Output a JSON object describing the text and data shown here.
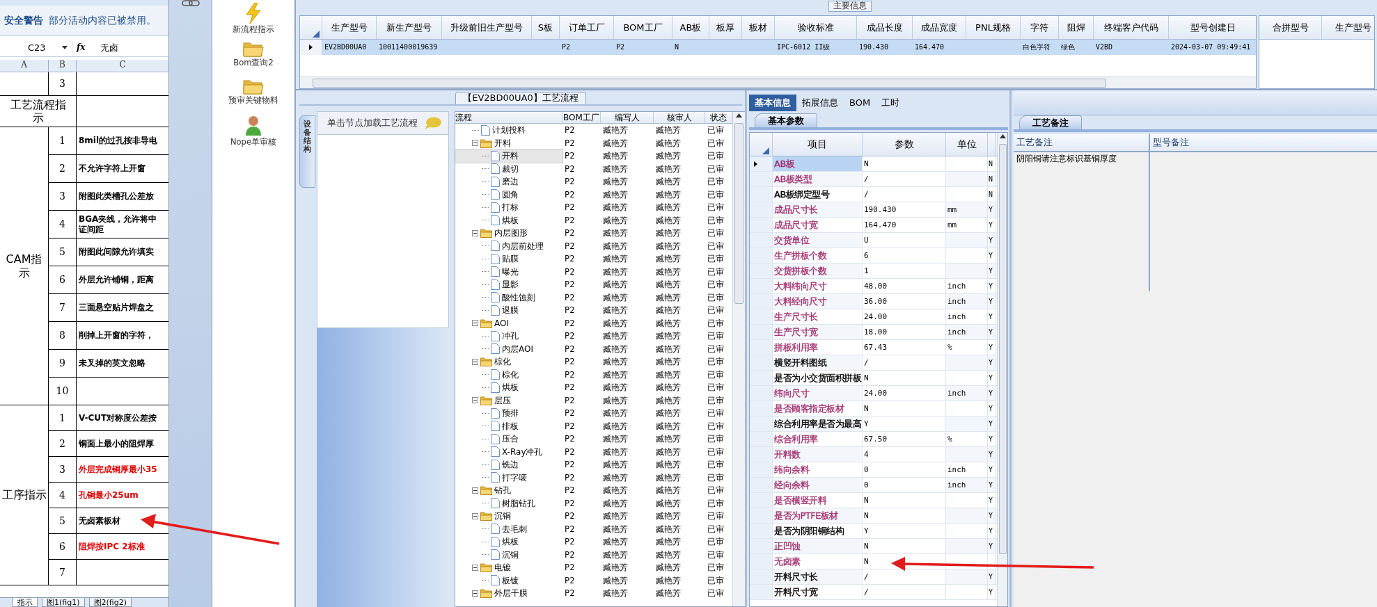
{
  "excel": {
    "warning_title": "安全警告",
    "warning_text": "部分活动内容已被禁用。",
    "name_box": "C23",
    "fx_label": "fx",
    "formula": "无卤",
    "columns": [
      "A",
      "B",
      "C"
    ],
    "top_rows": [
      {
        "number": "3"
      }
    ],
    "flow_label": "工艺流程指示",
    "groups": [
      {
        "label": "CAM指示",
        "items": [
          {
            "number": "1",
            "text": "8mil的过孔按非导电",
            "color": "#000000"
          },
          {
            "number": "2",
            "text": "不允许字符上开窗",
            "color": "#000000"
          },
          {
            "number": "3",
            "text": "附图此类槽孔公差放",
            "color": "#000000"
          },
          {
            "number": "4",
            "text": "BGA夹线，允许将中证间距",
            "color": "#000000"
          },
          {
            "number": "5",
            "text": "附图此间隙允许填实",
            "color": "#000000"
          },
          {
            "number": "6",
            "text": "外层允许铺铜，距离",
            "color": "#000000"
          },
          {
            "number": "7",
            "text": "三面悬空贴片焊盘之",
            "color": "#000000"
          },
          {
            "number": "8",
            "text": "削掉上开窗的字符，",
            "color": "#000000"
          },
          {
            "number": "9",
            "text": "未叉掉的英文忽略",
            "color": "#000000"
          },
          {
            "number": "10"
          }
        ]
      },
      {
        "label": "工序指示",
        "items": [
          {
            "number": "1",
            "text": "V-CUT对称度公差按",
            "color": "#000000"
          },
          {
            "number": "2",
            "text": "铜面上最小的阻焊厚",
            "color": "#000000"
          },
          {
            "number": "3",
            "text": "外层完成铜厚最小35",
            "color": "#e00000"
          },
          {
            "number": "4",
            "text": "孔铜最小25um",
            "color": "#e00000"
          },
          {
            "number": "5",
            "text": "无卤素板材",
            "color": "#000000"
          },
          {
            "number": "6",
            "text": "阻焊按IPC 2标准",
            "color": "#e00000"
          },
          {
            "number": "7"
          }
        ]
      }
    ],
    "sheet_tabs": [
      {
        "label": "指示",
        "selected": true
      },
      {
        "label": "图1(fig1)",
        "selected": false
      },
      {
        "label": "图2(fig2)",
        "selected": false
      }
    ]
  },
  "toolbar": [
    {
      "label": "新流程指示",
      "kind": "lightning"
    },
    {
      "label": "Bom查询2",
      "kind": "folder"
    },
    {
      "label": "预审关键物料",
      "kind": "folder"
    },
    {
      "label": "Nope单审核",
      "kind": "person"
    }
  ],
  "main_info": {
    "title": "主要信息",
    "columns": [
      "生产型号",
      "新生产型号",
      "升级前旧生产型号",
      "S板",
      "订单工厂",
      "BOM工厂",
      "AB板",
      "板厚",
      "板材",
      "验收标准",
      "成品长度",
      "成品宽度",
      "PNL规格",
      "字符",
      "阻焊",
      "终端客户代码",
      "型号创建日"
    ],
    "rows": [
      {
        "selected": true,
        "cells": [
          "EV2BD00UA0",
          "10011400019639",
          null,
          null,
          "P2",
          "P2",
          "N",
          null,
          null,
          "IPC-6012 II级",
          "190.430",
          "164.470",
          null,
          "白色字符",
          "绿色",
          "V2BD",
          "2024-03-07 09:49:41"
        ]
      }
    ],
    "side_columns": [
      "合拼型号",
      "生产型号"
    ]
  },
  "process": {
    "title": "【EV2BD00UA0】工艺流程",
    "side_tab": "设备结构",
    "hint": "单击节点加载工艺流程",
    "columns": [
      "流程",
      "BOM工厂",
      "编写人",
      "核审人",
      "状态"
    ],
    "rows": [
      {
        "kind": "file",
        "label": "计划投料",
        "factory": "P2",
        "writer": "臧艳芳",
        "reviewer": "臧艳芳",
        "status": "已审",
        "selected": false
      },
      {
        "kind": "folder",
        "label": "开料",
        "factory": "P2",
        "writer": "臧艳芳",
        "reviewer": "臧艳芳",
        "status": "已审",
        "selected": false,
        "expanded": true,
        "children": [
          {
            "kind": "file",
            "label": "开料",
            "factory": "P2",
            "writer": "臧艳芳",
            "reviewer": "臧艳芳",
            "status": "已审",
            "selected": true
          },
          {
            "kind": "file",
            "label": "裁切",
            "factory": "P2",
            "writer": "臧艳芳",
            "reviewer": "臧艳芳",
            "status": "已审",
            "selected": false
          },
          {
            "kind": "file",
            "label": "磨边",
            "factory": "P2",
            "writer": "臧艳芳",
            "reviewer": "臧艳芳",
            "status": "已审",
            "selected": false
          },
          {
            "kind": "file",
            "label": "圆角",
            "factory": "P2",
            "writer": "臧艳芳",
            "reviewer": "臧艳芳",
            "status": "已审",
            "selected": false
          },
          {
            "kind": "file",
            "label": "打标",
            "factory": "P2",
            "writer": "臧艳芳",
            "reviewer": "臧艳芳",
            "status": "已审",
            "selected": false
          },
          {
            "kind": "file",
            "label": "烘板",
            "factory": "P2",
            "writer": "臧艳芳",
            "reviewer": "臧艳芳",
            "status": "已审",
            "selected": false
          }
        ]
      },
      {
        "kind": "folder",
        "label": "内层图形",
        "factory": "P2",
        "writer": "臧艳芳",
        "reviewer": "臧艳芳",
        "status": "已审",
        "selected": false,
        "expanded": true,
        "children": [
          {
            "kind": "file",
            "label": "内层前处理",
            "factory": "P2",
            "writer": "臧艳芳",
            "reviewer": "臧艳芳",
            "status": "已审",
            "selected": false
          },
          {
            "kind": "file",
            "label": "贴膜",
            "factory": "P2",
            "writer": "臧艳芳",
            "reviewer": "臧艳芳",
            "status": "已审",
            "selected": false
          },
          {
            "kind": "file",
            "label": "曝光",
            "factory": "P2",
            "writer": "臧艳芳",
            "reviewer": "臧艳芳",
            "status": "已审",
            "selected": false
          },
          {
            "kind": "file",
            "label": "显影",
            "factory": "P2",
            "writer": "臧艳芳",
            "reviewer": "臧艳芳",
            "status": "已审",
            "selected": false
          },
          {
            "kind": "file",
            "label": "酸性蚀刻",
            "factory": "P2",
            "writer": "臧艳芳",
            "reviewer": "臧艳芳",
            "status": "已审",
            "selected": false
          },
          {
            "kind": "file",
            "label": "退膜",
            "factory": "P2",
            "writer": "臧艳芳",
            "reviewer": "臧艳芳",
            "status": "已审",
            "selected": false
          }
        ]
      },
      {
        "kind": "folder",
        "label": "AOI",
        "factory": "P2",
        "writer": "臧艳芳",
        "reviewer": "臧艳芳",
        "status": "已审",
        "selected": false,
        "expanded": true,
        "children": [
          {
            "kind": "file",
            "label": "冲孔",
            "factory": "P2",
            "writer": "臧艳芳",
            "reviewer": "臧艳芳",
            "status": "已审",
            "selected": false
          },
          {
            "kind": "file",
            "label": "内层AOI",
            "factory": "P2",
            "writer": "臧艳芳",
            "reviewer": "臧艳芳",
            "status": "已审",
            "selected": false
          }
        ]
      },
      {
        "kind": "folder",
        "label": "棕化",
        "factory": "P2",
        "writer": "臧艳芳",
        "reviewer": "臧艳芳",
        "status": "已审",
        "selected": false,
        "expanded": true,
        "children": [
          {
            "kind": "file",
            "label": "棕化",
            "factory": "P2",
            "writer": "臧艳芳",
            "reviewer": "臧艳芳",
            "status": "已审",
            "selected": false
          },
          {
            "kind": "file",
            "label": "烘板",
            "factory": "P2",
            "writer": "臧艳芳",
            "reviewer": "臧艳芳",
            "status": "已审",
            "selected": false
          }
        ]
      },
      {
        "kind": "folder",
        "label": "层压",
        "factory": "P2",
        "writer": "臧艳芳",
        "reviewer": "臧艳芳",
        "status": "已审",
        "selected": false,
        "expanded": true,
        "children": [
          {
            "kind": "file",
            "label": "预排",
            "factory": "P2",
            "writer": "臧艳芳",
            "reviewer": "臧艳芳",
            "status": "已审",
            "selected": false
          },
          {
            "kind": "file",
            "label": "排板",
            "factory": "P2",
            "writer": "臧艳芳",
            "reviewer": "臧艳芳",
            "status": "已审",
            "selected": false
          },
          {
            "kind": "file",
            "label": "压合",
            "factory": "P2",
            "writer": "臧艳芳",
            "reviewer": "臧艳芳",
            "status": "已审",
            "selected": false
          },
          {
            "kind": "file",
            "label": "X-Ray冲孔",
            "factory": "P2",
            "writer": "臧艳芳",
            "reviewer": "臧艳芳",
            "status": "已审",
            "selected": false
          },
          {
            "kind": "file",
            "label": "铣边",
            "factory": "P2",
            "writer": "臧艳芳",
            "reviewer": "臧艳芳",
            "status": "已审",
            "selected": false
          },
          {
            "kind": "file",
            "label": "打字唛",
            "factory": "P2",
            "writer": "臧艳芳",
            "reviewer": "臧艳芳",
            "status": "已审",
            "selected": false
          }
        ]
      },
      {
        "kind": "folder",
        "label": "钻孔",
        "factory": "P2",
        "writer": "臧艳芳",
        "reviewer": "臧艳芳",
        "status": "已审",
        "selected": false,
        "expanded": true,
        "children": [
          {
            "kind": "file",
            "label": "树脂钻孔",
            "factory": "P2",
            "writer": "臧艳芳",
            "reviewer": "臧艳芳",
            "status": "已审",
            "selected": false
          }
        ]
      },
      {
        "kind": "folder",
        "label": "沉铜",
        "factory": "P2",
        "writer": "臧艳芳",
        "reviewer": "臧艳芳",
        "status": "已审",
        "selected": false,
        "expanded": true,
        "children": [
          {
            "kind": "file",
            "label": "去毛刺",
            "factory": "P2",
            "writer": "臧艳芳",
            "reviewer": "臧艳芳",
            "status": "已审",
            "selected": false
          },
          {
            "kind": "file",
            "label": "烘板",
            "factory": "P2",
            "writer": "臧艳芳",
            "reviewer": "臧艳芳",
            "status": "已审",
            "selected": false
          },
          {
            "kind": "file",
            "label": "沉铜",
            "factory": "P2",
            "writer": "臧艳芳",
            "reviewer": "臧艳芳",
            "status": "已审",
            "selected": false
          }
        ]
      },
      {
        "kind": "folder",
        "label": "电镀",
        "factory": "P2",
        "writer": "臧艳芳",
        "reviewer": "臧艳芳",
        "status": "已审",
        "selected": false,
        "expanded": true,
        "children": [
          {
            "kind": "file",
            "label": "板镀",
            "factory": "P2",
            "writer": "臧艳芳",
            "reviewer": "臧艳芳",
            "status": "已审",
            "selected": false
          }
        ]
      },
      {
        "kind": "folder",
        "label": "外层干膜",
        "factory": "P2",
        "writer": "臧艳芳",
        "reviewer": "臧艳芳",
        "status": "已审",
        "selected": false,
        "expanded": true
      }
    ]
  },
  "params": {
    "tabs": [
      {
        "label": "基本信息",
        "selected": true
      },
      {
        "label": "拓展信息",
        "selected": false
      },
      {
        "label": "BOM",
        "selected": false
      },
      {
        "label": "工时",
        "selected": false
      }
    ],
    "subtab": "基本参数",
    "columns": [
      "项目",
      "参数",
      "单位"
    ],
    "rows": [
      {
        "item": "AB板",
        "value": "N",
        "flag": "N",
        "color": "#a0306e",
        "selected": true
      },
      {
        "item": "AB板类型",
        "value": "/",
        "flag": "N",
        "color": "#a0306e",
        "selected": false
      },
      {
        "item": "AB板绑定型号",
        "value": "/",
        "flag": "N",
        "color": "#000000",
        "selected": false
      },
      {
        "item": "成品尺寸长",
        "value": "190.430",
        "unit": "mm",
        "flag": "Y",
        "color": "#a0306e",
        "selected": false
      },
      {
        "item": "成品尺寸宽",
        "value": "164.470",
        "unit": "mm",
        "flag": "Y",
        "color": "#a0306e",
        "selected": false
      },
      {
        "item": "交货单位",
        "value": "U",
        "flag": "Y",
        "color": "#a0306e",
        "selected": false
      },
      {
        "item": "生产拼板个数",
        "value": "6",
        "flag": "Y",
        "color": "#a0306e",
        "selected": false
      },
      {
        "item": "交货拼板个数",
        "value": "1",
        "flag": "Y",
        "color": "#a0306e",
        "selected": false
      },
      {
        "item": "大料纬向尺寸",
        "value": "48.00",
        "unit": "inch",
        "flag": "Y",
        "color": "#a0306e",
        "selected": false
      },
      {
        "item": "大料经向尺寸",
        "value": "36.00",
        "unit": "inch",
        "flag": "Y",
        "color": "#a0306e",
        "selected": false
      },
      {
        "item": "生产尺寸长",
        "value": "24.00",
        "unit": "inch",
        "flag": "Y",
        "color": "#a0306e",
        "selected": false
      },
      {
        "item": "生产尺寸宽",
        "value": "18.00",
        "unit": "inch",
        "flag": "Y",
        "color": "#a0306e",
        "selected": false
      },
      {
        "item": "拼板利用率",
        "value": "67.43",
        "unit": "%",
        "flag": "Y",
        "color": "#a0306e",
        "selected": false
      },
      {
        "item": "横竖开料图纸",
        "value": "/",
        "flag": "Y",
        "color": "#000000",
        "selected": false
      },
      {
        "item": "是否为小交货面积拼板",
        "value": "N",
        "flag": "Y",
        "color": "#000000",
        "selected": false
      },
      {
        "item": "纬向尺寸",
        "value": "24.00",
        "unit": "inch",
        "flag": "Y",
        "color": "#a0306e",
        "selected": false
      },
      {
        "item": "是否顾客指定板材",
        "value": "N",
        "flag": "Y",
        "color": "#a0306e",
        "selected": false
      },
      {
        "item": "综合利用率是否为最高",
        "value": "Y",
        "flag": "Y",
        "color": "#000000",
        "selected": false
      },
      {
        "item": "综合利用率",
        "value": "67.50",
        "unit": "%",
        "flag": "Y",
        "color": "#a0306e",
        "selected": false
      },
      {
        "item": "开料数",
        "value": "4",
        "flag": "Y",
        "color": "#a0306e",
        "selected": false
      },
      {
        "item": "纬向余料",
        "value": "0",
        "unit": "inch",
        "flag": "Y",
        "color": "#a0306e",
        "selected": false
      },
      {
        "item": "经向余料",
        "value": "0",
        "unit": "inch",
        "flag": "Y",
        "color": "#a0306e",
        "selected": false
      },
      {
        "item": "是否横竖开料",
        "value": "N",
        "flag": "Y",
        "color": "#a0306e",
        "selected": false
      },
      {
        "item": "是否为PTFE板材",
        "value": "N",
        "flag": "Y",
        "color": "#a0306e",
        "selected": false
      },
      {
        "item": "是否为阴阳铜结构",
        "value": "Y",
        "flag": "Y",
        "color": "#000000",
        "selected": false
      },
      {
        "item": "正凹蚀",
        "value": "N",
        "flag": "Y",
        "color": "#a0306e",
        "selected": false
      },
      {
        "item": "无卤素",
        "value": "N",
        "color": "#a0306e",
        "selected": false
      },
      {
        "item": "开料尺寸长",
        "value": "/",
        "flag": "Y",
        "color": "#000000",
        "selected": false
      },
      {
        "item": "开料尺寸宽",
        "value": "/",
        "flag": "Y",
        "color": "#000000",
        "selected": false
      }
    ]
  },
  "notes": {
    "tab": "工艺备注",
    "columns": [
      "工艺备注",
      "型号备注"
    ],
    "process_note": "阴阳铜请注意标识基铜厚度"
  }
}
